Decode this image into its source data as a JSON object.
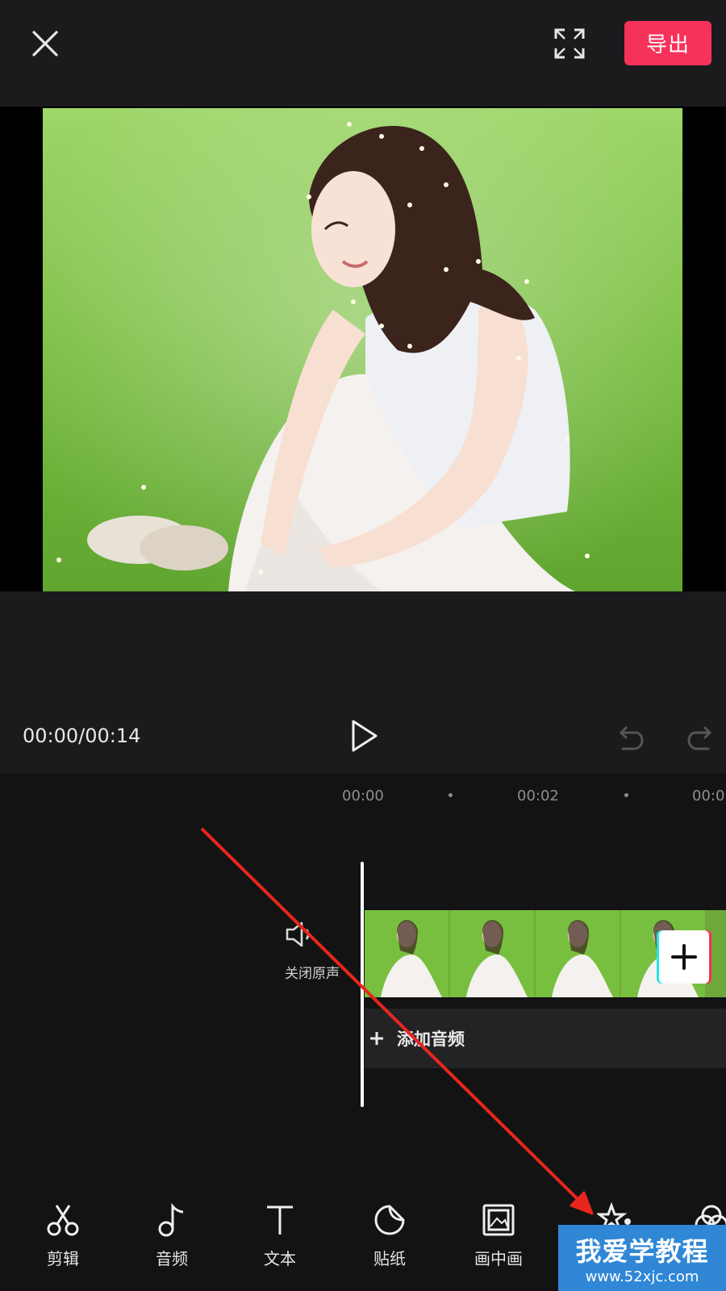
{
  "header": {
    "export_label": "导出"
  },
  "playback": {
    "time": "00:00/00:14"
  },
  "timeline": {
    "ruler": [
      "00:00",
      "00:02",
      "00:0"
    ],
    "mute_label": "关闭原声",
    "add_audio_label": "添加音频"
  },
  "toolbar": {
    "items": [
      {
        "label": "剪辑",
        "icon": "scissors-icon"
      },
      {
        "label": "音频",
        "icon": "music-note-icon"
      },
      {
        "label": "文本",
        "icon": "text-icon"
      },
      {
        "label": "贴纸",
        "icon": "sticker-icon"
      },
      {
        "label": "画中画",
        "icon": "picture-in-picture-icon"
      },
      {
        "label": "",
        "icon": "effects-star-icon"
      },
      {
        "label": "",
        "icon": "filter-icon"
      }
    ]
  },
  "watermark": {
    "line1": "我爱学教程",
    "line2": "www.52xjc.com"
  },
  "colors": {
    "export": "#f7325a",
    "background": "#131313",
    "annotation_arrow": "#e8261d"
  }
}
